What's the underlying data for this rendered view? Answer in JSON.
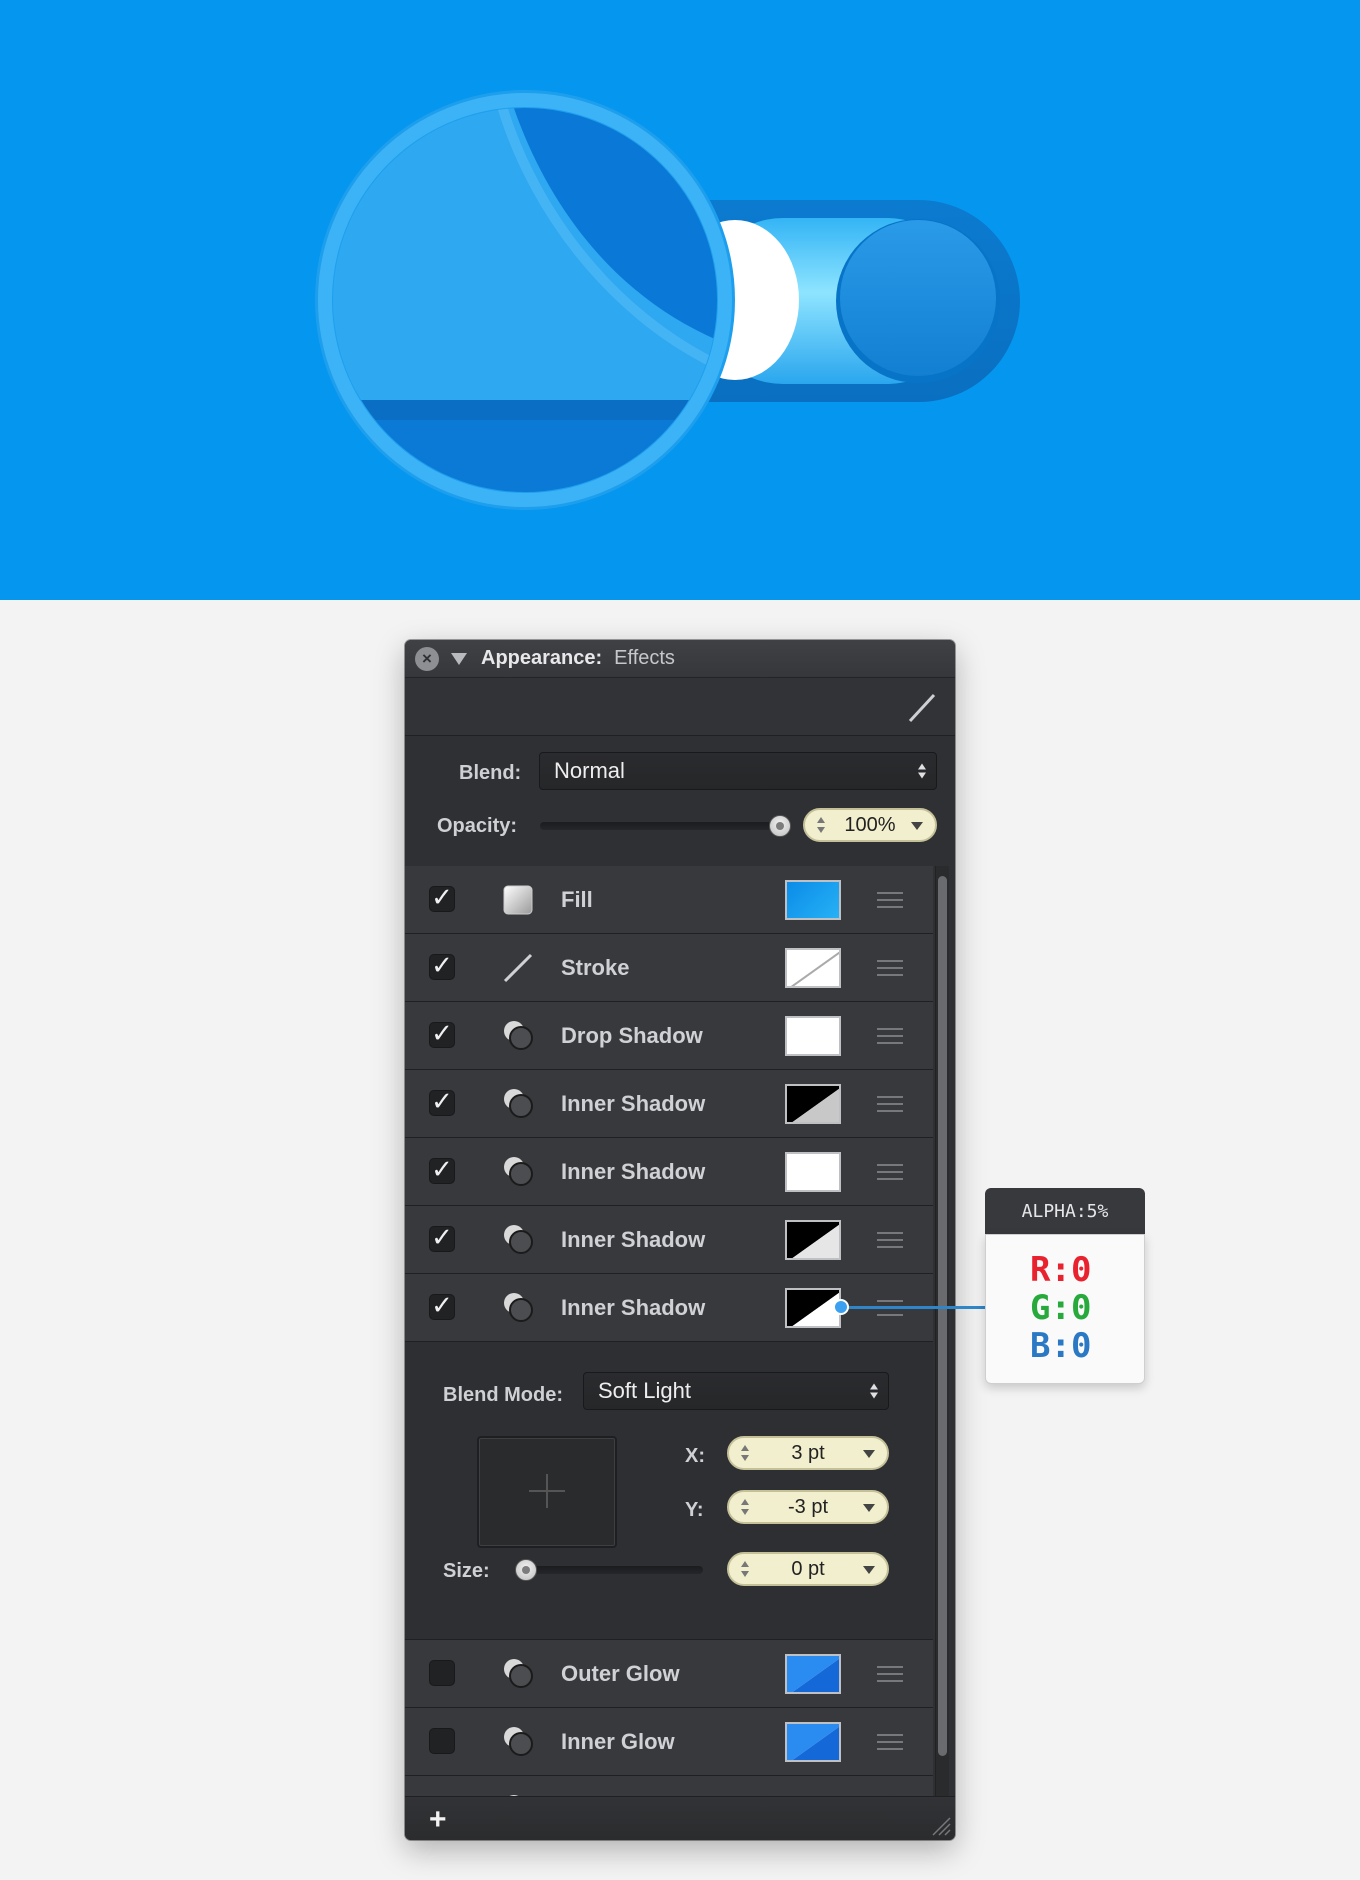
{
  "panel": {
    "title": "Appearance:",
    "subtitle": "Effects",
    "toolbar": [
      {
        "icon": "line-icon",
        "active": false
      },
      {
        "icon": "brush-icon",
        "active": false
      },
      {
        "icon": "square-icon",
        "active": false
      },
      {
        "icon": "tag-icon",
        "active": false
      },
      {
        "icon": "text-icon",
        "active": false
      },
      {
        "icon": "effects-icon",
        "active": true
      }
    ],
    "blend_label": "Blend:",
    "blend_value": "Normal",
    "opacity_label": "Opacity:",
    "opacity_value": "100%",
    "opacity_fraction": 1.0,
    "effects": [
      {
        "label": "Fill",
        "checked": true,
        "icon": "fill-icon",
        "swatch": "blue-gradient"
      },
      {
        "label": "Stroke",
        "checked": true,
        "icon": "stroke-icon",
        "swatch": "none"
      },
      {
        "label": "Drop Shadow",
        "checked": true,
        "icon": "shadow-icon",
        "swatch": "white"
      },
      {
        "label": "Inner Shadow",
        "checked": true,
        "icon": "shadow-icon",
        "swatch": "black-grey"
      },
      {
        "label": "Inner Shadow",
        "checked": true,
        "icon": "shadow-icon",
        "swatch": "white"
      },
      {
        "label": "Inner Shadow",
        "checked": true,
        "icon": "shadow-icon",
        "swatch": "black-lightgrey"
      },
      {
        "label": "Inner Shadow",
        "checked": true,
        "icon": "shadow-icon",
        "swatch": "black-white"
      }
    ],
    "editor": {
      "blend_mode_label": "Blend Mode:",
      "blend_mode_value": "Soft Light",
      "x_label": "X:",
      "x_value": "3 pt",
      "y_label": "Y:",
      "y_value": "-3 pt",
      "size_label": "Size:",
      "size_value": "0 pt",
      "size_fraction": 0.0
    },
    "effects_after": [
      {
        "label": "Outer Glow",
        "checked": false,
        "icon": "shadow-icon",
        "swatch": "blue-split"
      },
      {
        "label": "Inner Glow",
        "checked": false,
        "icon": "shadow-icon",
        "swatch": "blue-split"
      }
    ],
    "add_label": "+"
  },
  "callout": {
    "header": "ALPHA:5%",
    "r": "R:0",
    "g": "G:0",
    "b": "B:0",
    "colors": {
      "r": "#e8232f",
      "g": "#27a93c",
      "b": "#2b78c4"
    }
  },
  "colors": {
    "hero_bg": "#0596ef",
    "toggle_blue": "#0a84dc",
    "panel_bg": "#2f3033",
    "field_bg": "#f2efcf"
  }
}
